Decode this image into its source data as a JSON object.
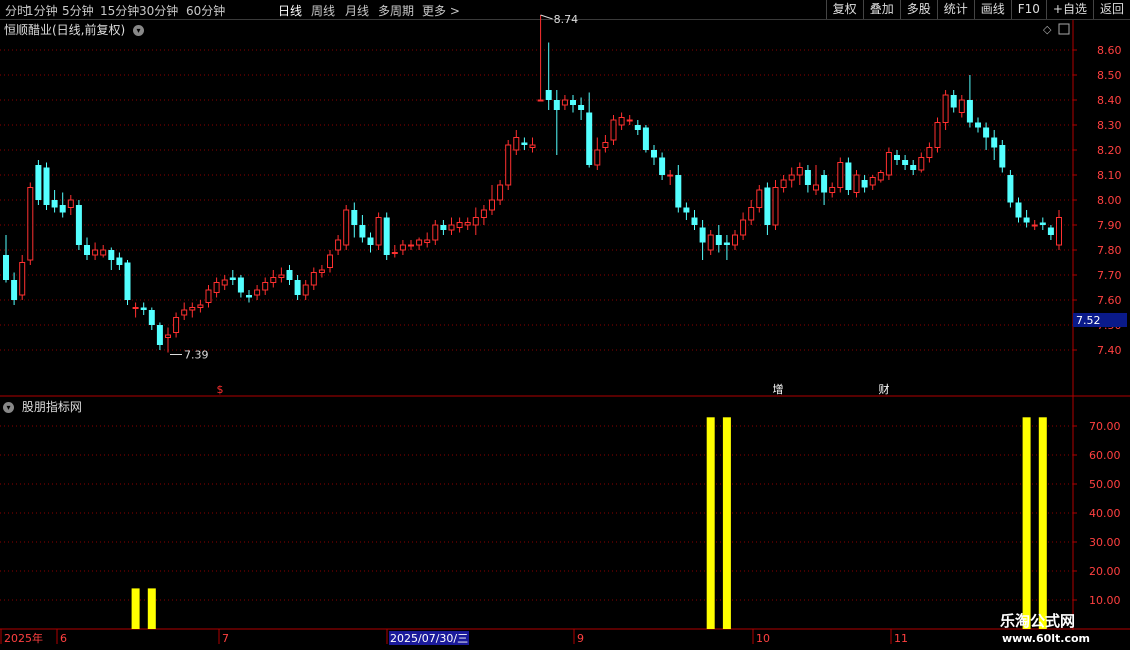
{
  "toolbar": {
    "periods": [
      {
        "label": "分时",
        "active": false
      },
      {
        "label": "1分钟",
        "active": false
      },
      {
        "label": "5分钟",
        "active": false
      },
      {
        "label": "15分钟",
        "active": false
      },
      {
        "label": "30分钟",
        "active": false
      },
      {
        "label": "60分钟",
        "active": false
      },
      {
        "label": "日线",
        "active": true
      },
      {
        "label": "周线",
        "active": false
      },
      {
        "label": "月线",
        "active": false
      },
      {
        "label": "多周期",
        "active": false
      },
      {
        "label": "更多 >",
        "active": false
      }
    ],
    "buttons": [
      "复权",
      "叠加",
      "多股",
      "统计",
      "画线",
      "F10",
      "+自选",
      "返回"
    ]
  },
  "main": {
    "title": "恒顺醋业(日线,前复权)",
    "high_label": "8.74",
    "low_label": "7.39",
    "current_price": "7.52",
    "markers": [
      {
        "text": "$",
        "color": "#ff3030"
      },
      {
        "text": "增",
        "color": "#ffffff"
      },
      {
        "text": "财",
        "color": "#ffffff"
      }
    ]
  },
  "indicator": {
    "title": "股朋指标网",
    "axis_labels": [
      "70.00",
      "60.00",
      "50.00",
      "40.00",
      "30.00",
      "20.00",
      "10.00"
    ]
  },
  "date_axis": {
    "labels": [
      "2025年",
      "6",
      "7",
      "2025/07/30/三",
      "9",
      "10",
      "11"
    ]
  },
  "watermark": {
    "line1": "乐淘公式网",
    "line2": "www.60lt.com"
  },
  "chart_data": {
    "type": "candlestick",
    "price_axis": {
      "ticks": [
        "8.60",
        "8.50",
        "8.40",
        "8.30",
        "8.20",
        "8.10",
        "8.00",
        "7.90",
        "7.80",
        "7.70",
        "7.60",
        "7.50",
        "7.40"
      ]
    },
    "candles": [
      [
        7.78,
        7.68,
        7.86,
        7.67
      ],
      [
        7.68,
        7.6,
        7.71,
        7.58
      ],
      [
        7.62,
        7.75,
        7.78,
        7.6
      ],
      [
        7.76,
        8.05,
        8.07,
        7.74
      ],
      [
        8.14,
        8.0,
        8.16,
        7.98
      ],
      [
        8.13,
        7.98,
        8.15,
        7.96
      ],
      [
        8.0,
        7.97,
        8.04,
        7.95
      ],
      [
        7.98,
        7.95,
        8.03,
        7.93
      ],
      [
        7.97,
        8.0,
        8.02,
        7.94
      ],
      [
        7.98,
        7.82,
        8.0,
        7.8
      ],
      [
        7.82,
        7.78,
        7.85,
        7.76
      ],
      [
        7.78,
        7.8,
        7.83,
        7.76
      ],
      [
        7.78,
        7.8,
        7.82,
        7.77
      ],
      [
        7.8,
        7.76,
        7.81,
        7.72
      ],
      [
        7.77,
        7.74,
        7.79,
        7.72
      ],
      [
        7.75,
        7.6,
        7.76,
        7.58
      ],
      [
        7.57,
        7.57,
        7.59,
        7.53
      ],
      [
        7.57,
        7.56,
        7.59,
        7.54
      ],
      [
        7.56,
        7.5,
        7.57,
        7.48
      ],
      [
        7.5,
        7.42,
        7.51,
        7.4
      ],
      [
        7.45,
        7.46,
        7.49,
        7.39
      ],
      [
        7.47,
        7.53,
        7.55,
        7.45
      ],
      [
        7.54,
        7.56,
        7.59,
        7.52
      ],
      [
        7.56,
        7.57,
        7.59,
        7.53
      ],
      [
        7.57,
        7.58,
        7.6,
        7.55
      ],
      [
        7.59,
        7.64,
        7.66,
        7.57
      ],
      [
        7.63,
        7.67,
        7.69,
        7.61
      ],
      [
        7.66,
        7.68,
        7.7,
        7.64
      ],
      [
        7.69,
        7.68,
        7.72,
        7.66
      ],
      [
        7.69,
        7.63,
        7.7,
        7.61
      ],
      [
        7.62,
        7.61,
        7.64,
        7.59
      ],
      [
        7.62,
        7.64,
        7.66,
        7.6
      ],
      [
        7.64,
        7.67,
        7.69,
        7.62
      ],
      [
        7.67,
        7.69,
        7.72,
        7.65
      ],
      [
        7.69,
        7.7,
        7.73,
        7.67
      ],
      [
        7.72,
        7.68,
        7.74,
        7.66
      ],
      [
        7.68,
        7.62,
        7.7,
        7.6
      ],
      [
        7.62,
        7.66,
        7.68,
        7.6
      ],
      [
        7.66,
        7.71,
        7.73,
        7.64
      ],
      [
        7.71,
        7.72,
        7.74,
        7.69
      ],
      [
        7.73,
        7.78,
        7.8,
        7.71
      ],
      [
        7.8,
        7.84,
        7.86,
        7.78
      ],
      [
        7.82,
        7.96,
        7.98,
        7.8
      ],
      [
        7.96,
        7.9,
        7.99,
        7.85
      ],
      [
        7.9,
        7.85,
        7.94,
        7.83
      ],
      [
        7.85,
        7.82,
        7.87,
        7.79
      ],
      [
        7.82,
        7.93,
        7.95,
        7.8
      ],
      [
        7.93,
        7.78,
        7.95,
        7.76
      ],
      [
        7.79,
        7.79,
        7.82,
        7.77
      ],
      [
        7.8,
        7.82,
        7.84,
        7.78
      ],
      [
        7.82,
        7.82,
        7.84,
        7.8
      ],
      [
        7.82,
        7.84,
        7.85,
        7.8
      ],
      [
        7.83,
        7.84,
        7.87,
        7.81
      ],
      [
        7.84,
        7.9,
        7.92,
        7.82
      ],
      [
        7.9,
        7.88,
        7.92,
        7.86
      ],
      [
        7.88,
        7.9,
        7.93,
        7.86
      ],
      [
        7.89,
        7.91,
        7.93,
        7.87
      ],
      [
        7.9,
        7.91,
        7.93,
        7.88
      ],
      [
        7.9,
        7.93,
        7.97,
        7.86
      ],
      [
        7.93,
        7.96,
        7.98,
        7.9
      ],
      [
        7.96,
        8.0,
        8.06,
        7.94
      ],
      [
        8.0,
        8.06,
        8.08,
        7.98
      ],
      [
        8.06,
        8.22,
        8.24,
        8.04
      ],
      [
        8.2,
        8.25,
        8.28,
        8.18
      ],
      [
        8.23,
        8.22,
        8.25,
        8.2
      ],
      [
        8.21,
        8.22,
        8.25,
        8.19
      ],
      [
        8.4,
        8.4,
        8.74,
        8.4
      ],
      [
        8.44,
        8.4,
        8.63,
        8.36
      ],
      [
        8.4,
        8.36,
        8.44,
        8.18
      ],
      [
        8.38,
        8.4,
        8.42,
        8.36
      ],
      [
        8.4,
        8.38,
        8.42,
        8.35
      ],
      [
        8.38,
        8.36,
        8.41,
        8.32
      ],
      [
        8.35,
        8.14,
        8.43,
        8.13
      ],
      [
        8.14,
        8.2,
        8.25,
        8.12
      ],
      [
        8.21,
        8.23,
        8.26,
        8.19
      ],
      [
        8.24,
        8.32,
        8.34,
        8.22
      ],
      [
        8.3,
        8.33,
        8.35,
        8.28
      ],
      [
        8.32,
        8.32,
        8.34,
        8.3
      ],
      [
        8.3,
        8.28,
        8.32,
        8.26
      ],
      [
        8.29,
        8.2,
        8.3,
        8.19
      ],
      [
        8.2,
        8.17,
        8.22,
        8.14
      ],
      [
        8.17,
        8.1,
        8.19,
        8.08
      ],
      [
        8.1,
        8.1,
        8.12,
        8.06
      ],
      [
        8.1,
        7.97,
        8.14,
        7.95
      ],
      [
        7.97,
        7.95,
        7.99,
        7.92
      ],
      [
        7.93,
        7.9,
        7.96,
        7.88
      ],
      [
        7.89,
        7.83,
        7.92,
        7.76
      ],
      [
        7.8,
        7.86,
        7.88,
        7.78
      ],
      [
        7.86,
        7.82,
        7.9,
        7.79
      ],
      [
        7.83,
        7.82,
        7.86,
        7.76
      ],
      [
        7.82,
        7.86,
        7.88,
        7.8
      ],
      [
        7.86,
        7.92,
        7.95,
        7.84
      ],
      [
        7.92,
        7.97,
        8.0,
        7.9
      ],
      [
        7.97,
        8.04,
        8.06,
        7.95
      ],
      [
        8.05,
        7.9,
        8.07,
        7.86
      ],
      [
        7.9,
        8.05,
        8.08,
        7.88
      ],
      [
        8.05,
        8.08,
        8.1,
        8.03
      ],
      [
        8.08,
        8.1,
        8.13,
        8.05
      ],
      [
        8.1,
        8.13,
        8.15,
        8.06
      ],
      [
        8.12,
        8.06,
        8.14,
        8.03
      ],
      [
        8.04,
        8.06,
        8.14,
        8.02
      ],
      [
        8.1,
        8.03,
        8.12,
        7.98
      ],
      [
        8.03,
        8.05,
        8.07,
        8.01
      ],
      [
        8.05,
        8.15,
        8.17,
        8.03
      ],
      [
        8.15,
        8.04,
        8.17,
        8.02
      ],
      [
        8.03,
        8.1,
        8.12,
        8.01
      ],
      [
        8.08,
        8.05,
        8.1,
        8.03
      ],
      [
        8.06,
        8.09,
        8.1,
        8.04
      ],
      [
        8.08,
        8.11,
        8.12,
        8.07
      ],
      [
        8.1,
        8.19,
        8.21,
        8.08
      ],
      [
        8.18,
        8.16,
        8.2,
        8.14
      ],
      [
        8.16,
        8.14,
        8.18,
        8.12
      ],
      [
        8.14,
        8.12,
        8.16,
        8.1
      ],
      [
        8.12,
        8.17,
        8.19,
        8.11
      ],
      [
        8.17,
        8.21,
        8.23,
        8.15
      ],
      [
        8.21,
        8.31,
        8.33,
        8.19
      ],
      [
        8.31,
        8.42,
        8.44,
        8.28
      ],
      [
        8.42,
        8.37,
        8.44,
        8.35
      ],
      [
        8.35,
        8.4,
        8.42,
        8.33
      ],
      [
        8.4,
        8.31,
        8.5,
        8.29
      ],
      [
        8.31,
        8.29,
        8.33,
        8.27
      ],
      [
        8.29,
        8.25,
        8.31,
        8.2
      ],
      [
        8.25,
        8.21,
        8.28,
        8.16
      ],
      [
        8.22,
        8.13,
        8.24,
        8.11
      ],
      [
        8.1,
        7.99,
        8.12,
        7.97
      ],
      [
        7.99,
        7.93,
        8.01,
        7.91
      ],
      [
        7.93,
        7.91,
        7.96,
        7.89
      ],
      [
        7.9,
        7.9,
        7.92,
        7.88
      ],
      [
        7.91,
        7.9,
        7.93,
        7.88
      ],
      [
        7.89,
        7.86,
        7.9,
        7.84
      ],
      [
        7.82,
        7.93,
        7.96,
        7.8
      ]
    ],
    "indicator_bars": [
      {
        "candle": 16,
        "value": 14
      },
      {
        "candle": 18,
        "value": 14
      },
      {
        "candle": 87,
        "value": 73
      },
      {
        "candle": 89,
        "value": 73
      },
      {
        "candle": 126,
        "value": 73
      },
      {
        "candle": 128,
        "value": 73
      }
    ],
    "indicator_axis": {
      "ylim": [
        0,
        75
      ]
    },
    "colors": {
      "up": "#ff3030",
      "down": "#54ffff",
      "indicator": "#ffff00",
      "grid": "#8b0000",
      "axis": "#b00000"
    }
  }
}
